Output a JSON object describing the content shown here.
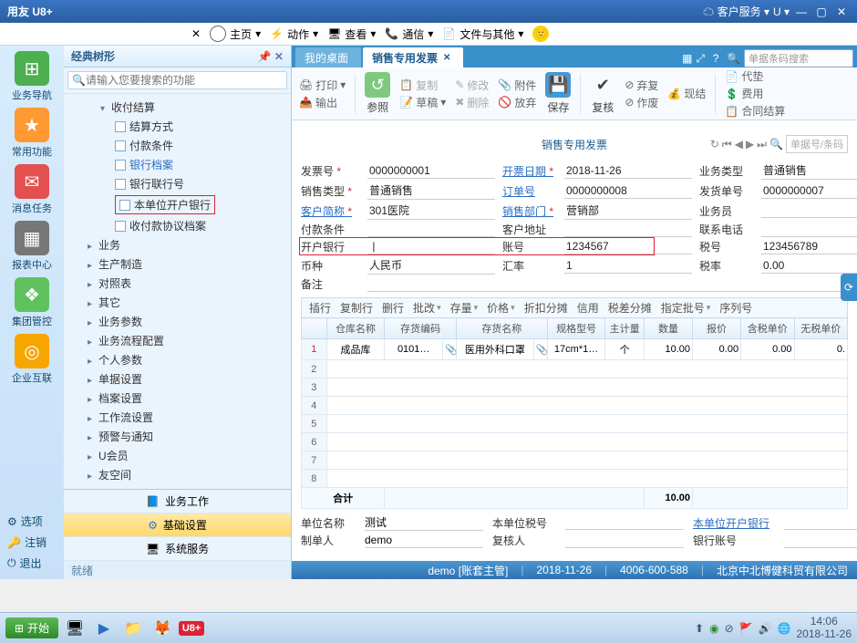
{
  "os_title": "用友 U8+",
  "service_menu": "客户服务",
  "app_toolbar": {
    "home": "主页",
    "actions": "动作",
    "view": "查看",
    "comm": "通信",
    "files": "文件与其他"
  },
  "left_icons": [
    {
      "label": "业务导航",
      "color": "#4caf50"
    },
    {
      "label": "常用功能",
      "color": "#ff9933"
    },
    {
      "label": "消息任务",
      "color": "#e35050"
    },
    {
      "label": "报表中心",
      "color": "#777"
    },
    {
      "label": "集团管控",
      "color": "#5fc25f"
    },
    {
      "label": "企业互联",
      "color": "#f7a500"
    }
  ],
  "left_bottom": {
    "options": "选项",
    "logout": "注销",
    "exit": "退出"
  },
  "tree": {
    "title": "经典树形",
    "search_placeholder": "请输入您要搜索的功能",
    "root": "收付结算",
    "children": [
      {
        "label": "结算方式"
      },
      {
        "label": "付款条件"
      },
      {
        "label": "银行档案",
        "link": true
      },
      {
        "label": "银行联行号"
      },
      {
        "label": "本单位开户银行",
        "hl": true
      },
      {
        "label": "收付款协议档案"
      }
    ],
    "siblings": [
      "业务",
      "生产制造",
      "对照表",
      "其它",
      "业务参数",
      "业务流程配置",
      "个人参数",
      "单据设置",
      "档案设置",
      "工作流设置",
      "预警与通知",
      "U会员",
      "友空间"
    ],
    "footer": {
      "work": "业务工作",
      "base": "基础设置",
      "sys": "系统服务"
    },
    "status": "就绪"
  },
  "doc_tabs": {
    "t1": "我的桌面",
    "t2": "销售专用发票",
    "search_ph": "单据条码搜索"
  },
  "ribbon": {
    "print": "打印",
    "output": "输出",
    "ref": "参照",
    "copy": "复制",
    "draft": "草稿",
    "edit": "修改",
    "delete": "删除",
    "attach": "附件",
    "abandon": "放弃",
    "save": "保存",
    "review": "复核",
    "void": "弃复",
    "ops": "作废",
    "cash": "现结",
    "credit": "代垫",
    "fee": "费用",
    "contract": "合同结算"
  },
  "form": {
    "title": "销售专用发票",
    "nav_search_ph": "单据号/条码",
    "labels": {
      "invoice_no": "发票号",
      "bill_date": "开票日期",
      "biz_type": "业务类型",
      "sales_type": "销售类型",
      "order_no": "订单号",
      "ship_no": "发货单号",
      "cust_abbr": "客户简称",
      "sales_dept": "销售部门",
      "salesman": "业务员",
      "pay_term": "付款条件",
      "cust_addr": "客户地址",
      "contact_tel": "联系电话",
      "bank": "开户银行",
      "account": "账号",
      "tax_no": "税号",
      "currency": "币种",
      "rate": "汇率",
      "tax_rate": "税率",
      "remark": "备注"
    },
    "values": {
      "invoice_no": "0000000001",
      "bill_date": "2018-11-26",
      "biz_type": "普通销售",
      "sales_type": "普通销售",
      "order_no": "0000000008",
      "ship_no": "0000000007",
      "cust_abbr": "301医院",
      "sales_dept": "营销部",
      "salesman": "",
      "pay_term": "",
      "cust_addr": "",
      "contact_tel": "",
      "bank": "",
      "account": "1234567",
      "tax_no": "123456789",
      "currency": "人民币",
      "rate": "1",
      "tax_rate": "0.00",
      "remark": ""
    }
  },
  "table": {
    "toolbar": [
      "插行",
      "复制行",
      "删行",
      "批改",
      "存量",
      "价格",
      "折扣分摊",
      "信用",
      "税差分摊",
      "指定批号",
      "序列号"
    ],
    "headers": [
      "",
      "仓库名称",
      "存货编码",
      "存货名称",
      "规格型号",
      "主计量",
      "数量",
      "报价",
      "含税单价",
      "无税单价"
    ],
    "rows": [
      {
        "n": "1",
        "wh": "成品库",
        "code": "0101…",
        "att": "📎",
        "name": "医用外科口罩",
        "spec": "17cm*1…",
        "uom": "个",
        "qty": "10.00",
        "price": "0.00",
        "tax_price": "0.00",
        "notax": "0."
      }
    ],
    "sum_label": "合计",
    "sum_qty": "10.00"
  },
  "footer_form": {
    "unit_name_lbl": "单位名称",
    "unit_name": "测试",
    "unit_tax_lbl": "本单位税号",
    "unit_tax": "",
    "unit_bank_lbl": "本单位开户银行",
    "unit_bank": "",
    "maker_lbl": "制单人",
    "maker": "demo",
    "reviewer_lbl": "复核人",
    "reviewer": "",
    "bank_acc_lbl": "银行账号",
    "bank_acc": ""
  },
  "statusbar": {
    "user": "demo",
    "role": "[账套主管]",
    "date": "2018-11-26",
    "tel": "4006-600-588",
    "company": "北京中北博健科贸有限公司"
  },
  "taskbar": {
    "start": "开始",
    "time": "14:06",
    "date": "2018-11-26"
  }
}
